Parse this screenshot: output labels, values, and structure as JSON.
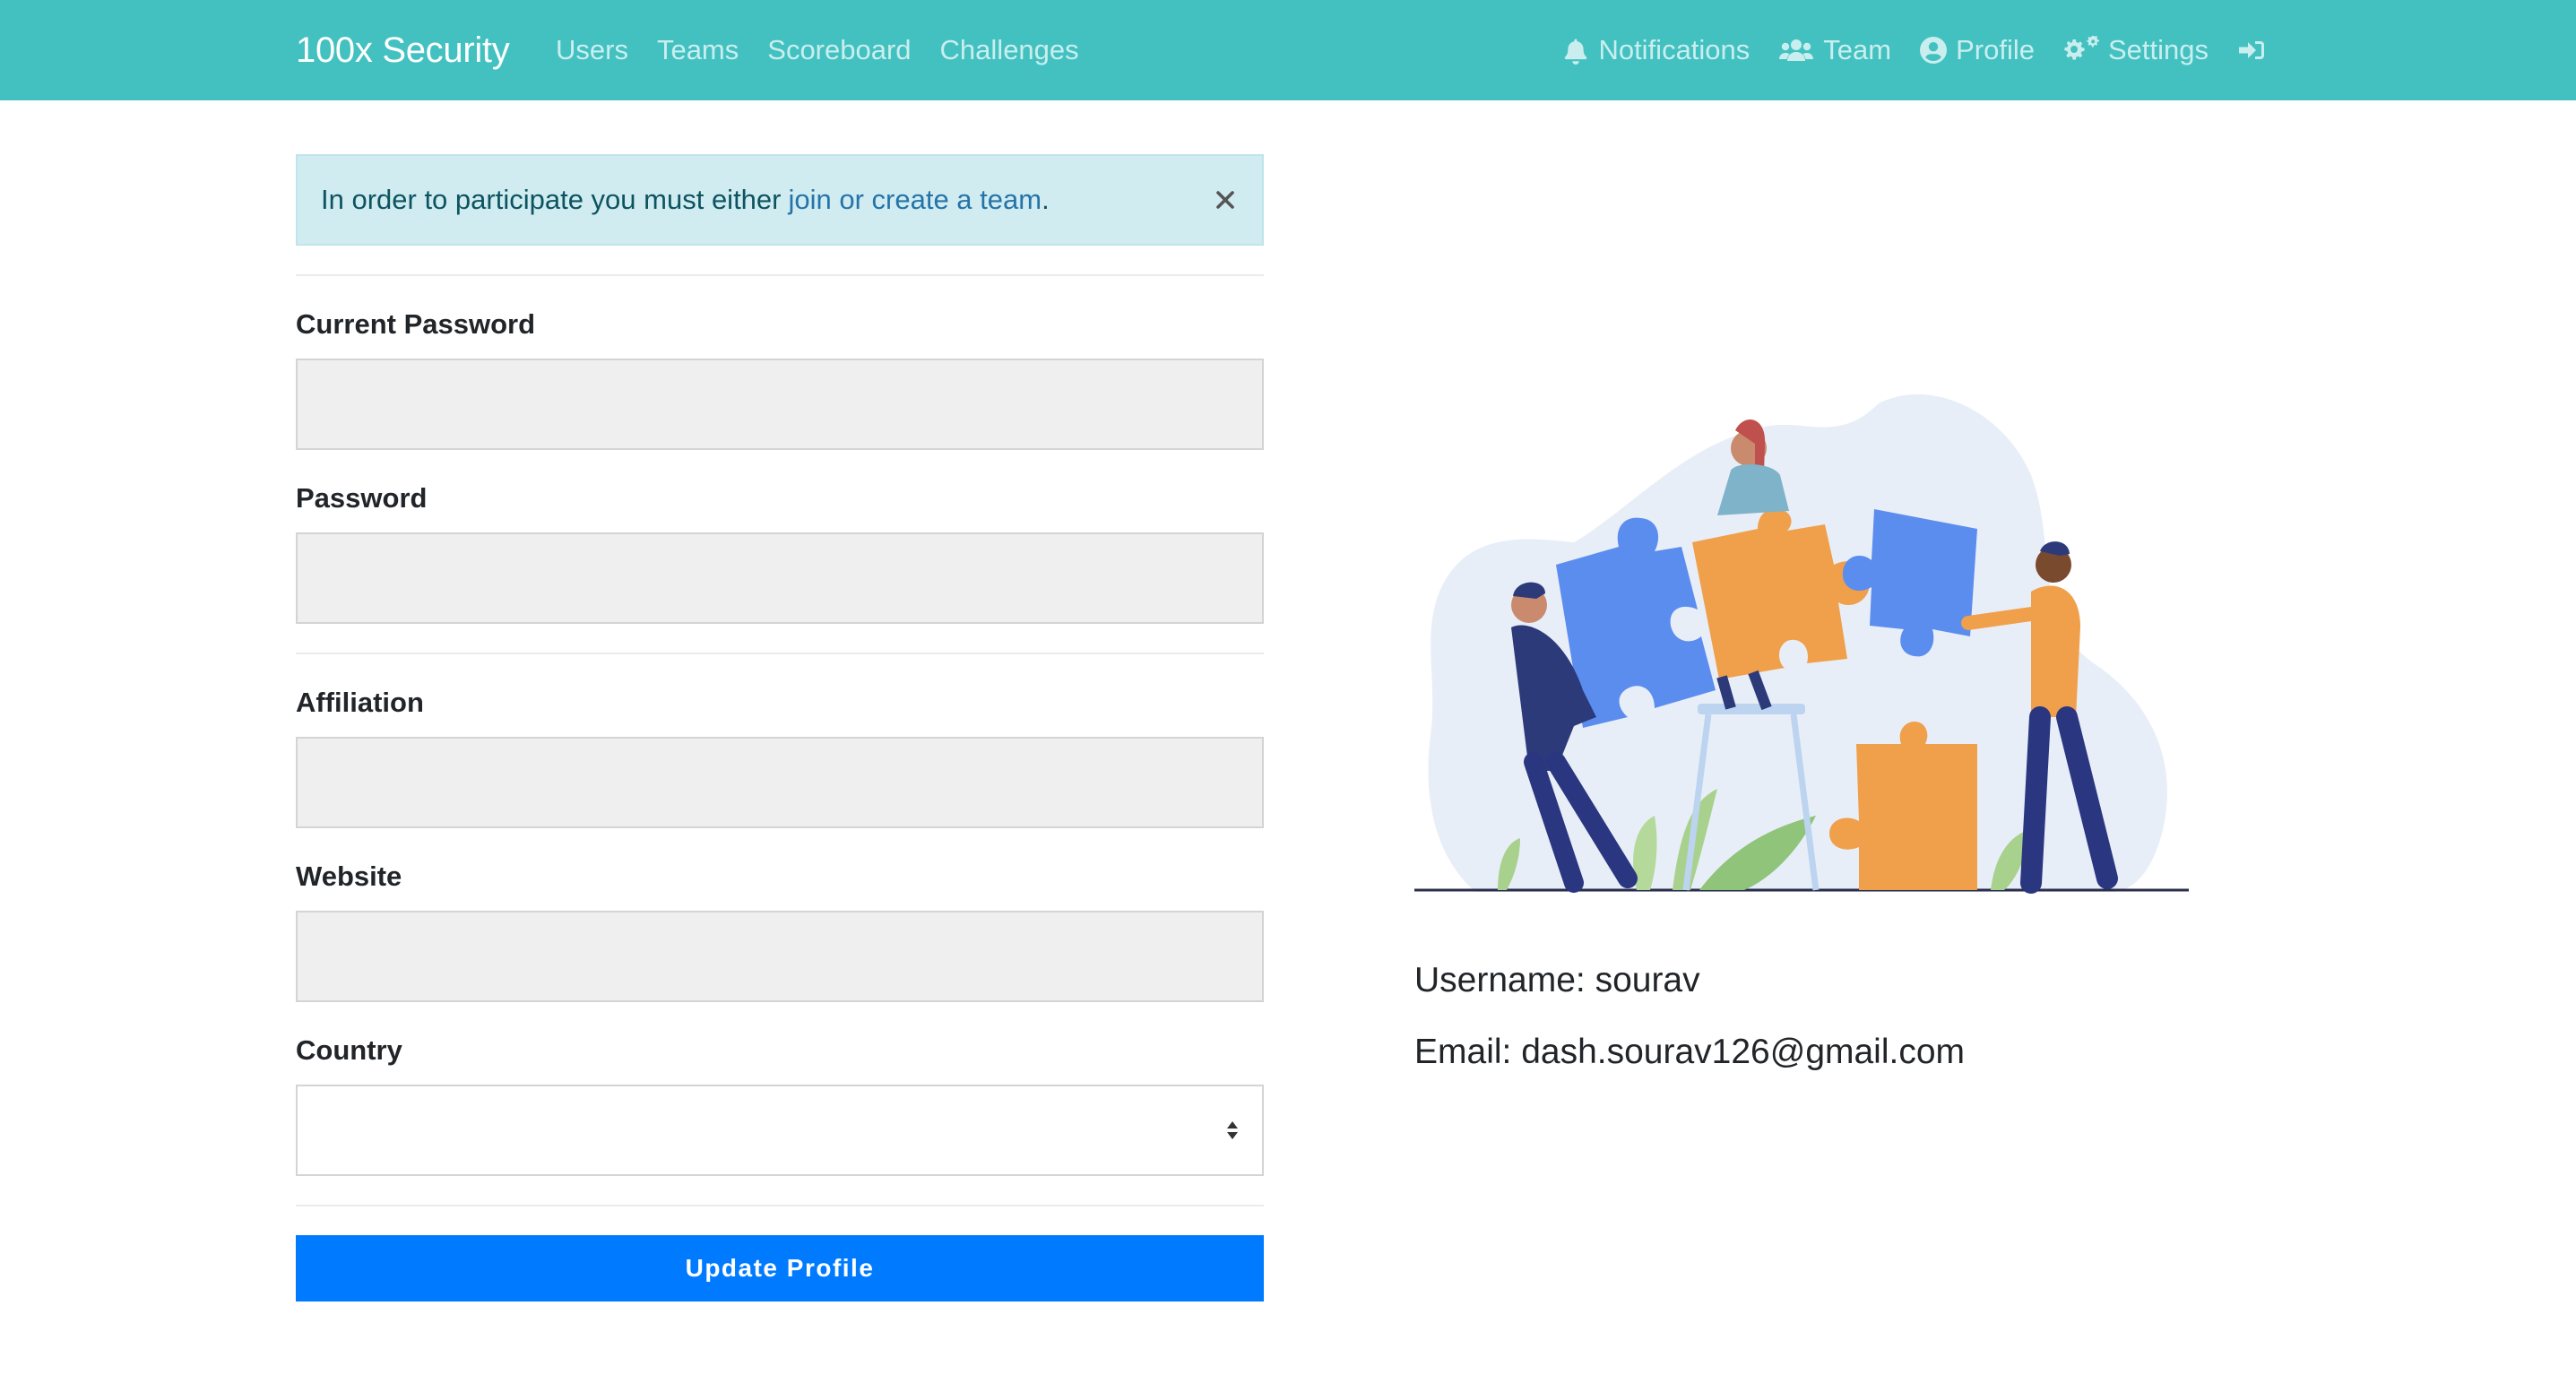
{
  "navbar": {
    "brand": "100x Security",
    "left_links": [
      "Users",
      "Teams",
      "Scoreboard",
      "Challenges"
    ],
    "right_links": {
      "notifications": "Notifications",
      "team": "Team",
      "profile": "Profile",
      "settings": "Settings"
    },
    "icons": [
      "bell-icon",
      "users-icon",
      "user-circle-icon",
      "cogs-icon",
      "logout-icon"
    ]
  },
  "alert": {
    "text_before": "In order to participate you must either",
    "link_text": "join or create a team",
    "text_after": ".",
    "close_icon": "close-icon"
  },
  "form": {
    "current_password_label": "Current Password",
    "current_password_value": "",
    "password_label": "Password",
    "password_value": "",
    "affiliation_label": "Affiliation",
    "affiliation_value": "",
    "website_label": "Website",
    "website_value": "",
    "country_label": "Country",
    "country_value": "",
    "submit_label": "Update Profile"
  },
  "profile": {
    "username": "Username: sourav",
    "email": "Email: dash.sourav126@gmail.com"
  },
  "colors": {
    "navbar": "#43c1c1",
    "primary": "#007bff",
    "alert_bg": "#d1ecf1",
    "alert_text": "#0c5460",
    "link": "#2574a9"
  }
}
